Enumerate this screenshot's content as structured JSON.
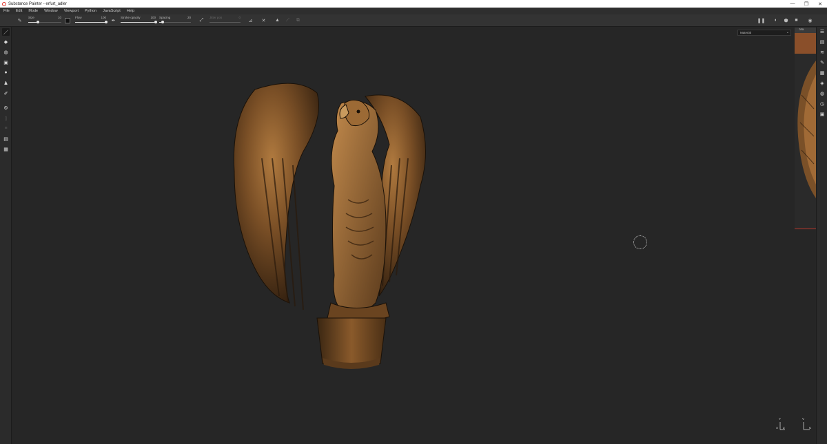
{
  "window": {
    "title": "Substance Painter - erfurt_adler",
    "minimize_glyph": "—",
    "restore_glyph": "❐",
    "close_glyph": "✕"
  },
  "menu": [
    "File",
    "Edit",
    "Mode",
    "Window",
    "Viewport",
    "Python",
    "JavaScript",
    "Help"
  ],
  "toolbar": {
    "size_label": "Size",
    "size_value": "10",
    "flow_label": "Flow",
    "flow_value": "100",
    "stroke_opacity_label": "Stroke opacity",
    "stroke_opacity_value": "100",
    "spacing_label": "Spacing",
    "spacing_value": "20",
    "jitter_label": "Jitter pos",
    "jitter_value": "0",
    "size_level": 0.3,
    "flow_level": 1.0,
    "stroke_opacity_level": 1.0,
    "spacing_level": 0.1
  },
  "viewport": {
    "material_dropdown": "Material",
    "gizmo_left": {
      "y": "Y",
      "x": "X",
      "z": "Z"
    },
    "gizmo_right": {
      "v": "V",
      "u": "U"
    }
  },
  "right_preview": {
    "tab_label": "Ma"
  },
  "icons": {
    "left_tools": [
      "paint-brush-icon",
      "eraser-icon",
      "projection-icon",
      "geometry-mask-icon",
      "smudge-icon",
      "clone-stamp-icon",
      "color-picker-icon",
      "settings-icon",
      "dim-icon-1",
      "dim-icon-2",
      "ps-export-icon",
      "clipboard-icon"
    ],
    "right_panels": [
      "texture-set-list-icon",
      "texture-set-settings-icon",
      "layers-icon",
      "properties-icon",
      "display-settings-icon",
      "shader-settings-icon",
      "viewer-settings-icon",
      "history-icon",
      "log-icon"
    ]
  },
  "colors": {
    "accent": "#c0392b",
    "viewport_bg": "#262626",
    "model_bronze": "#8a5a2b"
  }
}
